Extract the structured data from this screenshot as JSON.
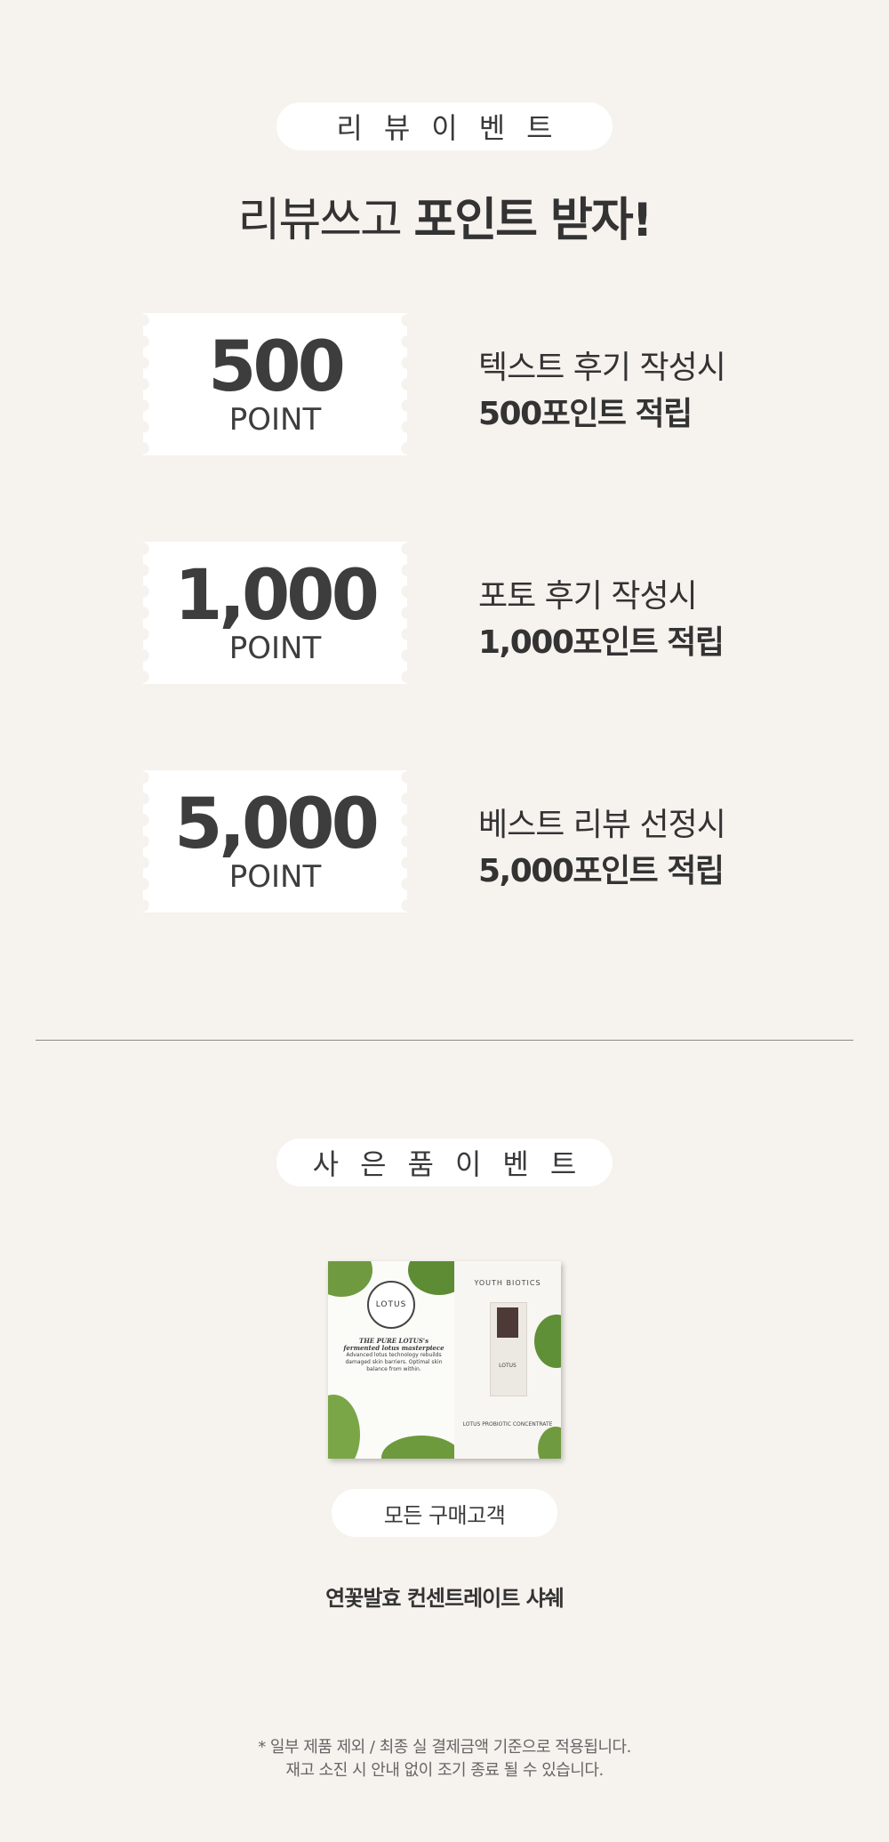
{
  "review_event": {
    "pill_label": "리뷰이벤트",
    "headline_light": "리뷰쓰고",
    "headline_bold": "포인트 받자!",
    "rewards": [
      {
        "amount": "500",
        "unit": "POINT",
        "desc_line1": "텍스트 후기 작성시",
        "desc_line2": "500포인트 적립"
      },
      {
        "amount": "1,000",
        "unit": "POINT",
        "desc_line1": "포토 후기 작성시",
        "desc_line2": "1,000포인트 적립"
      },
      {
        "amount": "5,000",
        "unit": "POINT",
        "desc_line1": "베스트 리뷰 선정시",
        "desc_line2": "5,000포인트 적립"
      }
    ]
  },
  "gift_event": {
    "pill_label": "사은품이벤트",
    "image": {
      "brand_left": "LOTUS",
      "copy_title": "THE PURE LOTUS's fermented lotus masterpiece",
      "copy_body": "Advanced lotus technology rebuilds damaged skin barriers. Optimal skin balance from within.",
      "brand_right": "YOUTH BIOTICS",
      "bottle_label": "LOTUS",
      "product_caption": "LOTUS PROBIOTIC CONCENTRATE"
    },
    "target_label": "모든 구매고객",
    "product_name": "연꽃발효 컨센트레이트 샤쉐"
  },
  "notices": [
    "* 일부 제품 제외 / 최종 실 결제금액 기준으로 적용됩니다.",
    "재고 소진 시 안내 없이 조기 종료 될 수 있습니다."
  ]
}
